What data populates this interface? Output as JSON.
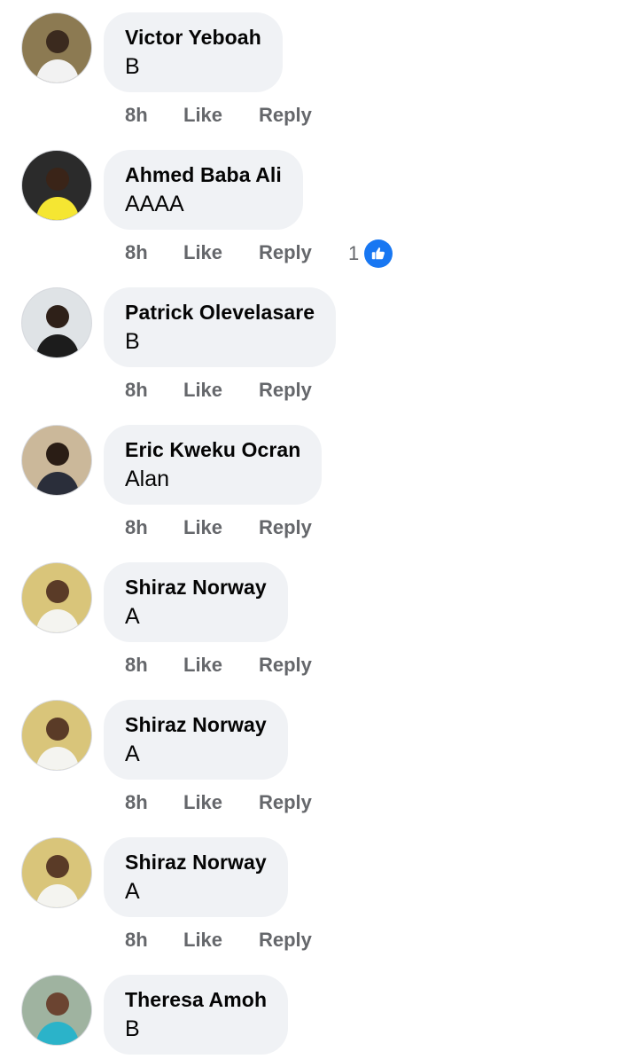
{
  "comments": [
    {
      "author": "Victor Yeboah",
      "text": "B",
      "time": "8h",
      "like_label": "Like",
      "reply_label": "Reply",
      "avatar_icon": "person-photo-icon",
      "avatar_colors": {
        "bg": "#8c7a52",
        "skin": "#3b2a1e",
        "shirt": "#f2f2f2"
      }
    },
    {
      "author": "Ahmed Baba Ali",
      "text": "AAAA",
      "time": "8h",
      "like_label": "Like",
      "reply_label": "Reply",
      "reaction_count": "1",
      "reaction_icon": "like-reaction-icon",
      "avatar_icon": "person-photo-icon",
      "avatar_colors": {
        "bg": "#2b2b2b",
        "skin": "#3a2418",
        "shirt": "#f5e632"
      }
    },
    {
      "author": "Patrick Olevelasare",
      "text": "B",
      "time": "8h",
      "like_label": "Like",
      "reply_label": "Reply",
      "avatar_icon": "person-photo-icon",
      "avatar_colors": {
        "bg": "#dfe3e6",
        "skin": "#2e2018",
        "shirt": "#1c1c1c"
      }
    },
    {
      "author": "Eric Kweku Ocran",
      "text": "Alan",
      "time": "8h",
      "like_label": "Like",
      "reply_label": "Reply",
      "avatar_icon": "person-photo-icon",
      "avatar_colors": {
        "bg": "#cbb89a",
        "skin": "#2a1d15",
        "shirt": "#2a2e3a"
      }
    },
    {
      "author": "Shiraz Norway",
      "text": "A",
      "time": "8h",
      "like_label": "Like",
      "reply_label": "Reply",
      "avatar_icon": "person-photo-icon",
      "avatar_colors": {
        "bg": "#d9c57a",
        "skin": "#5a3b27",
        "shirt": "#f4f4f0"
      }
    },
    {
      "author": "Shiraz Norway",
      "text": "A",
      "time": "8h",
      "like_label": "Like",
      "reply_label": "Reply",
      "avatar_icon": "person-photo-icon",
      "avatar_colors": {
        "bg": "#d9c57a",
        "skin": "#5a3b27",
        "shirt": "#f4f4f0"
      }
    },
    {
      "author": "Shiraz Norway",
      "text": "A",
      "time": "8h",
      "like_label": "Like",
      "reply_label": "Reply",
      "avatar_icon": "person-photo-icon",
      "avatar_colors": {
        "bg": "#d9c57a",
        "skin": "#5a3b27",
        "shirt": "#f4f4f0"
      }
    },
    {
      "author": "Theresa Amoh",
      "text": "B",
      "time": "",
      "like_label": "",
      "reply_label": "",
      "avatar_icon": "person-photo-icon",
      "avatar_colors": {
        "bg": "#9fb3a0",
        "skin": "#6b4431",
        "shirt": "#2bb3c9"
      }
    }
  ],
  "colors": {
    "bubble_bg": "#f0f2f5",
    "action_text": "#65676b",
    "like_blue": "#1877f2"
  }
}
